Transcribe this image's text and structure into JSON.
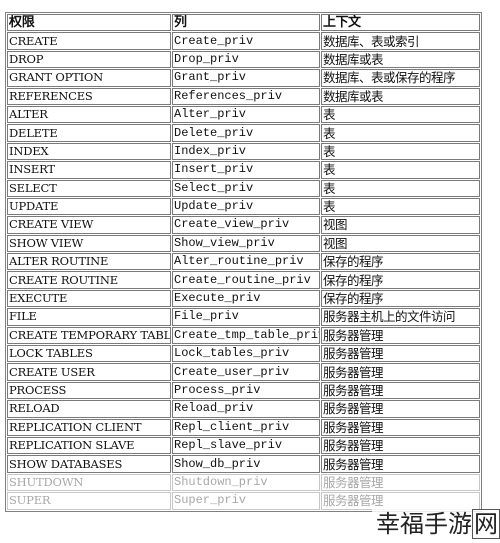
{
  "table": {
    "headers": [
      "权限",
      "列",
      "上下文"
    ],
    "rows": [
      {
        "privilege": "CREATE",
        "column": "Create_priv",
        "context": "数据库、表或索引",
        "faded": false
      },
      {
        "privilege": "DROP",
        "column": "Drop_priv",
        "context": "数据库或表",
        "faded": false
      },
      {
        "privilege": "GRANT OPTION",
        "column": "Grant_priv",
        "context": "数据库、表或保存的程序",
        "faded": false
      },
      {
        "privilege": "REFERENCES",
        "column": "References_priv",
        "context": "数据库或表",
        "faded": false
      },
      {
        "privilege": "ALTER",
        "column": "Alter_priv",
        "context": "表",
        "faded": false
      },
      {
        "privilege": "DELETE",
        "column": "Delete_priv",
        "context": "表",
        "faded": false
      },
      {
        "privilege": "INDEX",
        "column": "Index_priv",
        "context": "表",
        "faded": false
      },
      {
        "privilege": "INSERT",
        "column": "Insert_priv",
        "context": "表",
        "faded": false
      },
      {
        "privilege": "SELECT",
        "column": "Select_priv",
        "context": "表",
        "faded": false
      },
      {
        "privilege": "UPDATE",
        "column": "Update_priv",
        "context": "表",
        "faded": false
      },
      {
        "privilege": "CREATE VIEW",
        "column": "Create_view_priv",
        "context": "视图",
        "faded": false
      },
      {
        "privilege": "SHOW VIEW",
        "column": "Show_view_priv",
        "context": "视图",
        "faded": false
      },
      {
        "privilege": "ALTER ROUTINE",
        "column": "Alter_routine_priv",
        "context": "保存的程序",
        "faded": false
      },
      {
        "privilege": "CREATE ROUTINE",
        "column": "Create_routine_priv",
        "context": "保存的程序",
        "faded": false
      },
      {
        "privilege": "EXECUTE",
        "column": "Execute_priv",
        "context": "保存的程序",
        "faded": false
      },
      {
        "privilege": "FILE",
        "column": "File_priv",
        "context": "服务器主机上的文件访问",
        "faded": false
      },
      {
        "privilege": "CREATE TEMPORARY TABLES",
        "column": "Create_tmp_table_priv",
        "context": "服务器管理",
        "faded": false
      },
      {
        "privilege": "LOCK TABLES",
        "column": "Lock_tables_priv",
        "context": "服务器管理",
        "faded": false
      },
      {
        "privilege": "CREATE USER",
        "column": "Create_user_priv",
        "context": "服务器管理",
        "faded": false
      },
      {
        "privilege": "PROCESS",
        "column": "Process_priv",
        "context": "服务器管理",
        "faded": false
      },
      {
        "privilege": "RELOAD",
        "column": "Reload_priv",
        "context": "服务器管理",
        "faded": false
      },
      {
        "privilege": "REPLICATION CLIENT",
        "column": "Repl_client_priv",
        "context": "服务器管理",
        "faded": false
      },
      {
        "privilege": "REPLICATION SLAVE",
        "column": "Repl_slave_priv",
        "context": "服务器管理",
        "faded": false
      },
      {
        "privilege": "SHOW DATABASES",
        "column": "Show_db_priv",
        "context": "服务器管理",
        "faded": false
      },
      {
        "privilege": "SHUTDOWN",
        "column": "Shutdown_priv",
        "context": "服务器管理",
        "faded": true
      },
      {
        "privilege": "SUPER",
        "column": "Super_priv",
        "context": "服务器管理",
        "faded": true
      }
    ]
  },
  "watermark": {
    "text": "幸福手游",
    "last_char": "网"
  }
}
